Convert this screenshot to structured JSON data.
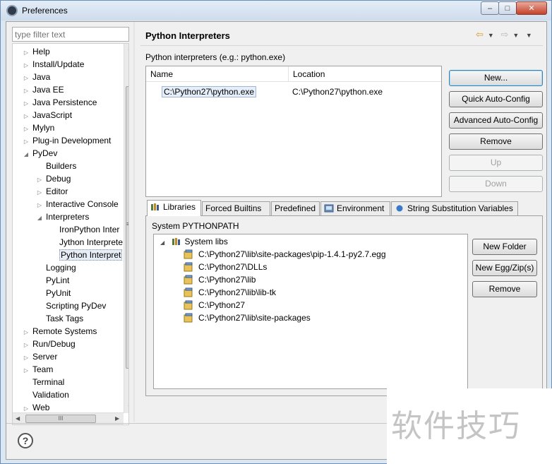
{
  "window": {
    "title": "Preferences",
    "minimize_label": "–",
    "maximize_label": "□",
    "close_label": "✕"
  },
  "filter": {
    "placeholder": "type filter text"
  },
  "tree": {
    "scroll_grip": "≡",
    "hscroll_grip": "III",
    "items": [
      {
        "label": "Help",
        "arrow": "▷"
      },
      {
        "label": "Install/Update",
        "arrow": "▷"
      },
      {
        "label": "Java",
        "arrow": "▷"
      },
      {
        "label": "Java EE",
        "arrow": "▷"
      },
      {
        "label": "Java Persistence",
        "arrow": "▷"
      },
      {
        "label": "JavaScript",
        "arrow": "▷"
      },
      {
        "label": "Mylyn",
        "arrow": "▷"
      },
      {
        "label": "Plug-in Development",
        "arrow": "▷"
      },
      {
        "label": "PyDev",
        "arrow": "◢"
      },
      {
        "label": "Builders",
        "arrow": ""
      },
      {
        "label": "Debug",
        "arrow": "▷"
      },
      {
        "label": "Editor",
        "arrow": "▷"
      },
      {
        "label": "Interactive Console",
        "arrow": "▷"
      },
      {
        "label": "Interpreters",
        "arrow": "◢"
      },
      {
        "label": "IronPython Inter",
        "arrow": ""
      },
      {
        "label": "Jython Interprete",
        "arrow": ""
      },
      {
        "label": "Python Interpret",
        "arrow": ""
      },
      {
        "label": "Logging",
        "arrow": ""
      },
      {
        "label": "PyLint",
        "arrow": ""
      },
      {
        "label": "PyUnit",
        "arrow": ""
      },
      {
        "label": "Scripting PyDev",
        "arrow": ""
      },
      {
        "label": "Task Tags",
        "arrow": ""
      },
      {
        "label": "Remote Systems",
        "arrow": "▷"
      },
      {
        "label": "Run/Debug",
        "arrow": "▷"
      },
      {
        "label": "Server",
        "arrow": "▷"
      },
      {
        "label": "Team",
        "arrow": "▷"
      },
      {
        "label": "Terminal",
        "arrow": ""
      },
      {
        "label": "Validation",
        "arrow": ""
      },
      {
        "label": "Web",
        "arrow": "▷"
      }
    ]
  },
  "page": {
    "title": "Python Interpreters",
    "subtitle": "Python interpreters (e.g.: python.exe)"
  },
  "interpreters": {
    "columns": {
      "name": "Name",
      "location": "Location"
    },
    "rows": [
      {
        "name": "C:\\Python27\\python.exe",
        "location": "C:\\Python27\\python.exe"
      }
    ]
  },
  "buttons": {
    "new": "New...",
    "quick_auto_config": "Quick Auto-Config",
    "advanced_auto_config": "Advanced Auto-Config",
    "remove": "Remove",
    "up": "Up",
    "down": "Down"
  },
  "tabs": [
    {
      "label": "Libraries"
    },
    {
      "label": "Forced Builtins"
    },
    {
      "label": "Predefined"
    },
    {
      "label": "Environment"
    },
    {
      "label": "String Substitution Variables"
    }
  ],
  "libraries": {
    "system_pythonpath_label": "System PYTHONPATH",
    "root_label": "System libs",
    "paths": [
      "C:\\Python27\\lib\\site-packages\\pip-1.4.1-py2.7.egg",
      "C:\\Python27\\DLLs",
      "C:\\Python27\\lib",
      "C:\\Python27\\lib\\lib-tk",
      "C:\\Python27",
      "C:\\Python27\\lib\\site-packages"
    ],
    "new_folder": "New Folder",
    "new_egg_zip": "New Egg/Zip(s)",
    "remove": "Remove"
  },
  "help": {
    "glyph": "?"
  },
  "watermark": {
    "text": "软件技巧"
  },
  "colors": {
    "accent": "#3c7fb1",
    "selection": "#e5eef9"
  }
}
